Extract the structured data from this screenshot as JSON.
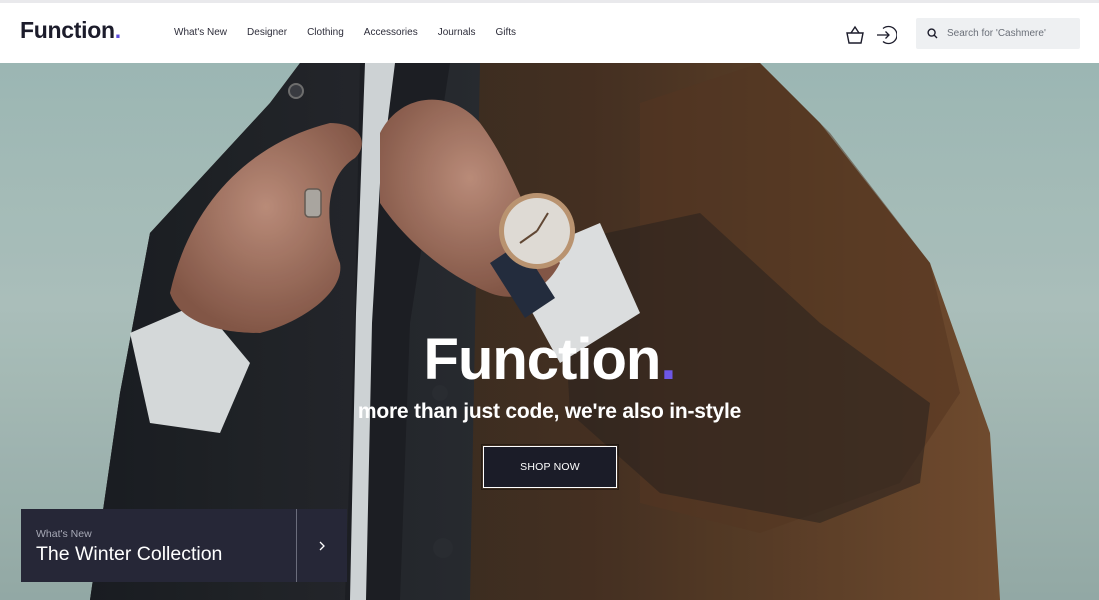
{
  "brand": {
    "name": "Function",
    "dot": "."
  },
  "nav": {
    "items": [
      {
        "label": "What's New"
      },
      {
        "label": "Designer"
      },
      {
        "label": "Clothing"
      },
      {
        "label": "Accessories"
      },
      {
        "label": "Journals"
      },
      {
        "label": "Gifts"
      }
    ]
  },
  "header_icons": {
    "bag": "shopping-bag-icon",
    "login": "login-arrow-icon"
  },
  "search": {
    "placeholder": "Search for 'Cashmere'",
    "value": ""
  },
  "hero": {
    "title": "Function",
    "title_dot": ".",
    "tagline": "more than just code, we're also in-style",
    "cta_label": "SHOP NOW"
  },
  "promo_card": {
    "kicker": "What's New",
    "title": "The Winter Collection",
    "arrow_icon": "chevron-right-icon"
  },
  "colors": {
    "accent": "#5b4bdb",
    "dark": "#1c1c2b",
    "card_bg": "#262737"
  }
}
